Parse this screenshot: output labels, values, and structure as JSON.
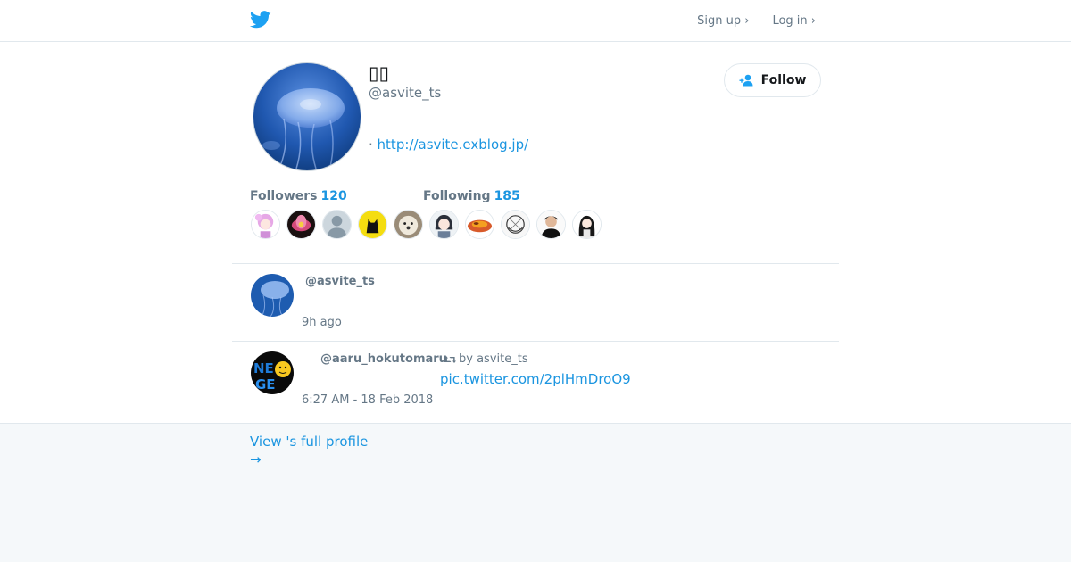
{
  "topbar": {
    "logo": "twitter-bird-icon",
    "signup_label": "Sign up ›",
    "login_label": "Log in ›"
  },
  "profile": {
    "display_name": "▯▯",
    "handle": "@asvite_ts",
    "website_prefix": "· ",
    "website_url": "http://asvite.exblog.jp/",
    "follow_label": "Follow",
    "followers_label": "Followers",
    "followers_count": "120",
    "following_label": "Following",
    "following_count": "185",
    "follower_avatars": [
      "pink-anime-girl",
      "pink-lotus",
      "default-avatar",
      "black-cat-yellow",
      "white-dog",
      "anime-girl-glasses",
      "food-plate",
      "manga-sketch",
      "man-portrait",
      "anime-girl-dark-hair"
    ]
  },
  "tweets": [
    {
      "user": "@asvite_ts",
      "time": "9h ago"
    },
    {
      "user": "@aaru_hokutomaru",
      "retweet_label": "by asvite_ts",
      "link": "pic.twitter.com/2plHmDroO9",
      "time": "6:27 AM - 18 Feb 2018"
    }
  ],
  "footer": {
    "view_profile": "View 's full profile",
    "arrow": "→"
  },
  "colors": {
    "accent": "#1b95e0",
    "muted": "#657786",
    "border": "#e1e8ed",
    "background": "#f5f8fa"
  }
}
